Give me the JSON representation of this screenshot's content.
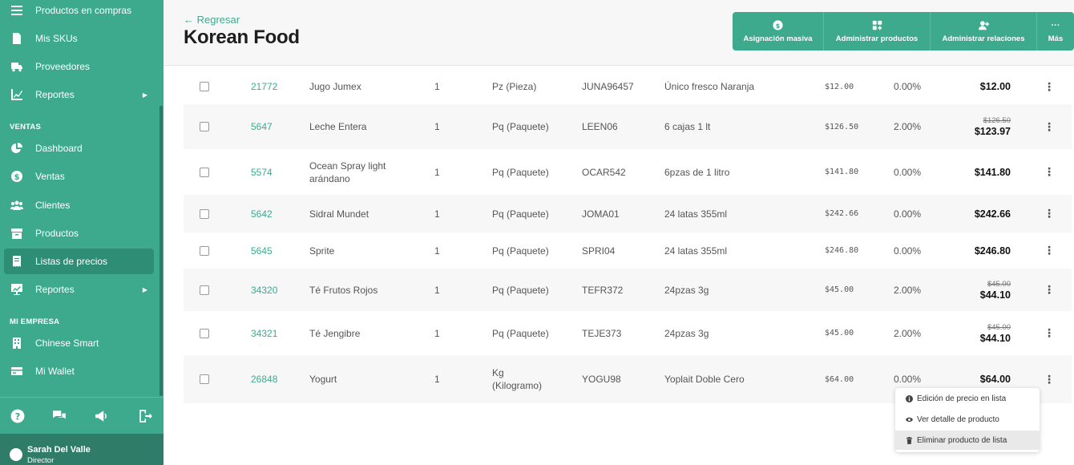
{
  "sidebar": {
    "top_items": [
      {
        "label": "Productos en compras",
        "icon": "list-icon"
      },
      {
        "label": "Mis SKUs",
        "icon": "document-icon"
      },
      {
        "label": "Proveedores",
        "icon": "truck-icon"
      },
      {
        "label": "Reportes",
        "icon": "chart-icon"
      }
    ],
    "sections": {
      "ventas": "VENTAS",
      "empresa": "MI EMPRESA"
    },
    "ventas_items": [
      {
        "label": "Dashboard",
        "icon": "pie-chart-icon"
      },
      {
        "label": "Ventas",
        "icon": "dollar-icon"
      },
      {
        "label": "Clientes",
        "icon": "users-icon"
      },
      {
        "label": "Productos",
        "icon": "archive-icon"
      },
      {
        "label": "Listas de precios",
        "icon": "receipt-icon"
      },
      {
        "label": "Reportes",
        "icon": "chart-board-icon"
      }
    ],
    "empresa_items": [
      {
        "label": "Chinese Smart",
        "icon": "building-icon"
      },
      {
        "label": "Mi Wallet",
        "icon": "wallet-icon"
      }
    ],
    "submenu_arrow": "▶",
    "user": {
      "name": "Sarah Del Valle",
      "role": "Director"
    }
  },
  "header": {
    "back_label": "← Regresar",
    "title": "Korean Food",
    "actions": [
      {
        "label": "Asignación masiva",
        "icon": "dollar-circle-icon"
      },
      {
        "label": "Administrar productos",
        "icon": "grid-plus-icon"
      },
      {
        "label": "Administrar relaciones",
        "icon": "user-plus-icon"
      },
      {
        "label": "Más",
        "icon": "more-icon",
        "glyph": "···"
      }
    ]
  },
  "kebab_glyph": "⋮",
  "rows": [
    {
      "id": "21772",
      "name": "Jugo Jumex",
      "qty": "1",
      "unit": "Pz (Pieza)",
      "sku": "JUNA96457",
      "desc": "Único fresco Naranja",
      "price": "$12.00",
      "discount": "0.00%",
      "old_price": "",
      "final": "$12.00"
    },
    {
      "id": "5647",
      "name": "Leche Entera",
      "qty": "1",
      "unit": "Pq (Paquete)",
      "sku": "LEEN06",
      "desc": "6 cajas 1 lt",
      "price": "$126.50",
      "discount": "2.00%",
      "old_price": "$126.50",
      "final": "$123.97"
    },
    {
      "id": "5574",
      "name": "Ocean Spray light arándano",
      "qty": "1",
      "unit": "Pq (Paquete)",
      "sku": "OCAR542",
      "desc": "6pzas de 1 litro",
      "price": "$141.80",
      "discount": "0.00%",
      "old_price": "",
      "final": "$141.80"
    },
    {
      "id": "5642",
      "name": "Sidral Mundet",
      "qty": "1",
      "unit": "Pq (Paquete)",
      "sku": "JOMA01",
      "desc": "24 latas 355ml",
      "price": "$242.66",
      "discount": "0.00%",
      "old_price": "",
      "final": "$242.66"
    },
    {
      "id": "5645",
      "name": "Sprite",
      "qty": "1",
      "unit": "Pq (Paquete)",
      "sku": "SPRI04",
      "desc": "24 latas 355ml",
      "price": "$246.80",
      "discount": "0.00%",
      "old_price": "",
      "final": "$246.80"
    },
    {
      "id": "34320",
      "name": "Té Frutos Rojos",
      "qty": "1",
      "unit": "Pq (Paquete)",
      "sku": "TEFR372",
      "desc": "24pzas 3g",
      "price": "$45.00",
      "discount": "2.00%",
      "old_price": "$45.00",
      "final": "$44.10"
    },
    {
      "id": "34321",
      "name": "Té Jengibre",
      "qty": "1",
      "unit": "Pq (Paquete)",
      "sku": "TEJE373",
      "desc": "24pzas 3g",
      "price": "$45.00",
      "discount": "2.00%",
      "old_price": "$45.00",
      "final": "$44.10"
    },
    {
      "id": "26848",
      "name": "Yogurt",
      "qty": "1",
      "unit": "Kg (Kilogramo)",
      "sku": "YOGU98",
      "desc": "Yoplait Doble Cero",
      "price": "$64.00",
      "discount": "0.00%",
      "old_price": "",
      "final": "$64.00"
    }
  ],
  "row_menu": [
    {
      "label": "Edición de precio en lista",
      "icon": "info-icon"
    },
    {
      "label": "Ver detalle de producto",
      "icon": "eye-icon"
    },
    {
      "label": "Eliminar producto de lista",
      "icon": "trash-icon"
    }
  ]
}
